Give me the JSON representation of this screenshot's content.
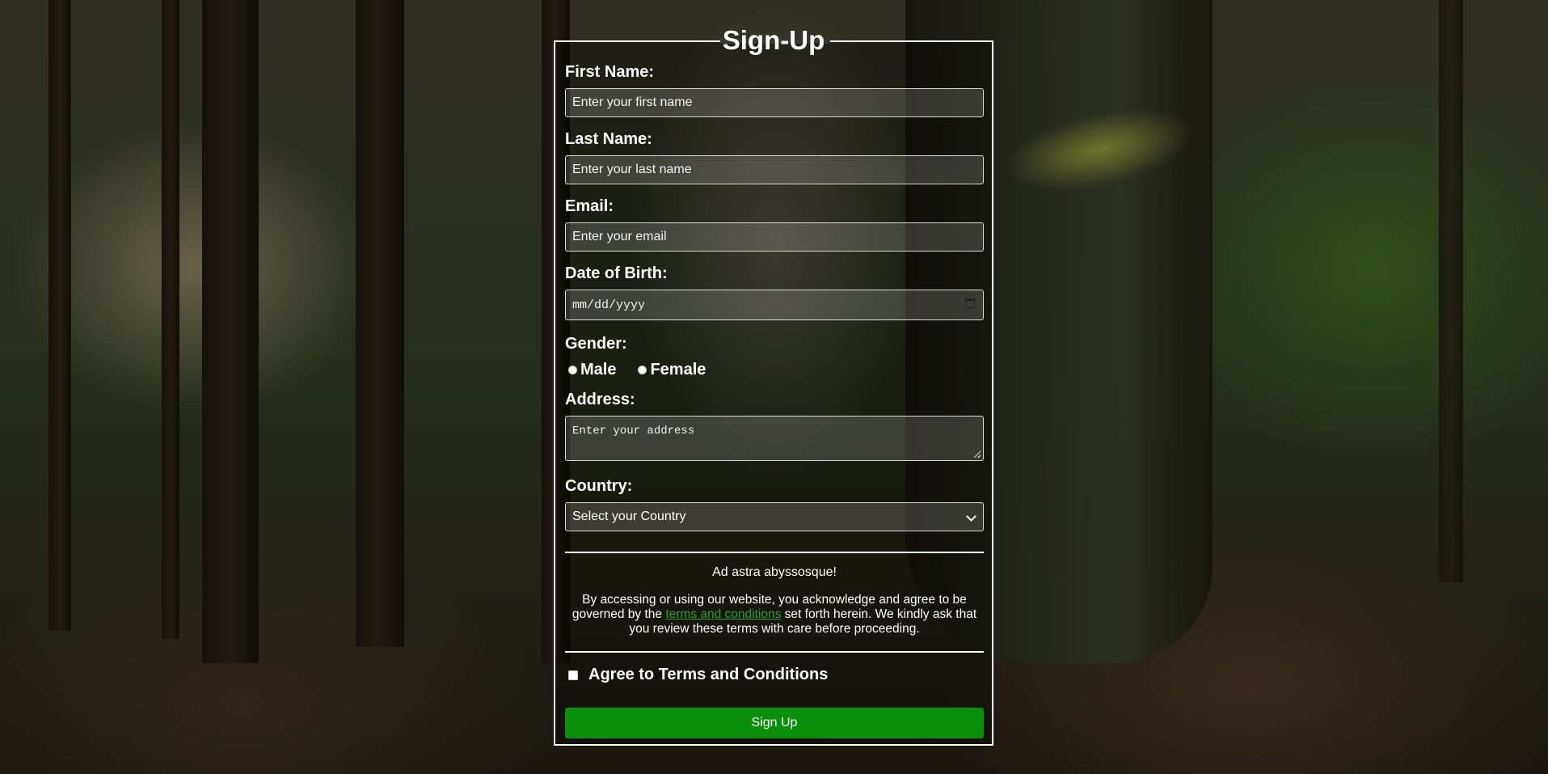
{
  "form": {
    "title": "Sign-Up",
    "first_name": {
      "label": "First Name:",
      "placeholder": "Enter your first name"
    },
    "last_name": {
      "label": "Last Name:",
      "placeholder": "Enter your last name"
    },
    "email": {
      "label": "Email:",
      "placeholder": "Enter your email"
    },
    "dob": {
      "label": "Date of Birth:",
      "placeholder": "mm/dd/yyyy"
    },
    "gender": {
      "label": "Gender:",
      "options": [
        "Male",
        "Female"
      ]
    },
    "address": {
      "label": "Address:",
      "placeholder": "Enter your address"
    },
    "country": {
      "label": "Country:",
      "selected": "Select your Country"
    },
    "motto": "Ad astra abyssosque!",
    "terms_before": "By accessing or using our website, you acknowledge and agree to be governed by the ",
    "terms_link": "terms and conditions",
    "terms_after": " set forth herein. We kindly ask that you review these terms with care before proceeding.",
    "agree_label": "Agree to Terms and Conditions",
    "submit_label": "Sign Up"
  },
  "colors": {
    "accent": "#0a8f0a",
    "link": "#2aa02a",
    "border": "#ffffff"
  },
  "icons": {
    "date": "calendar-icon",
    "select": "chevron-down-icon",
    "textarea": "resize-handle-icon"
  }
}
